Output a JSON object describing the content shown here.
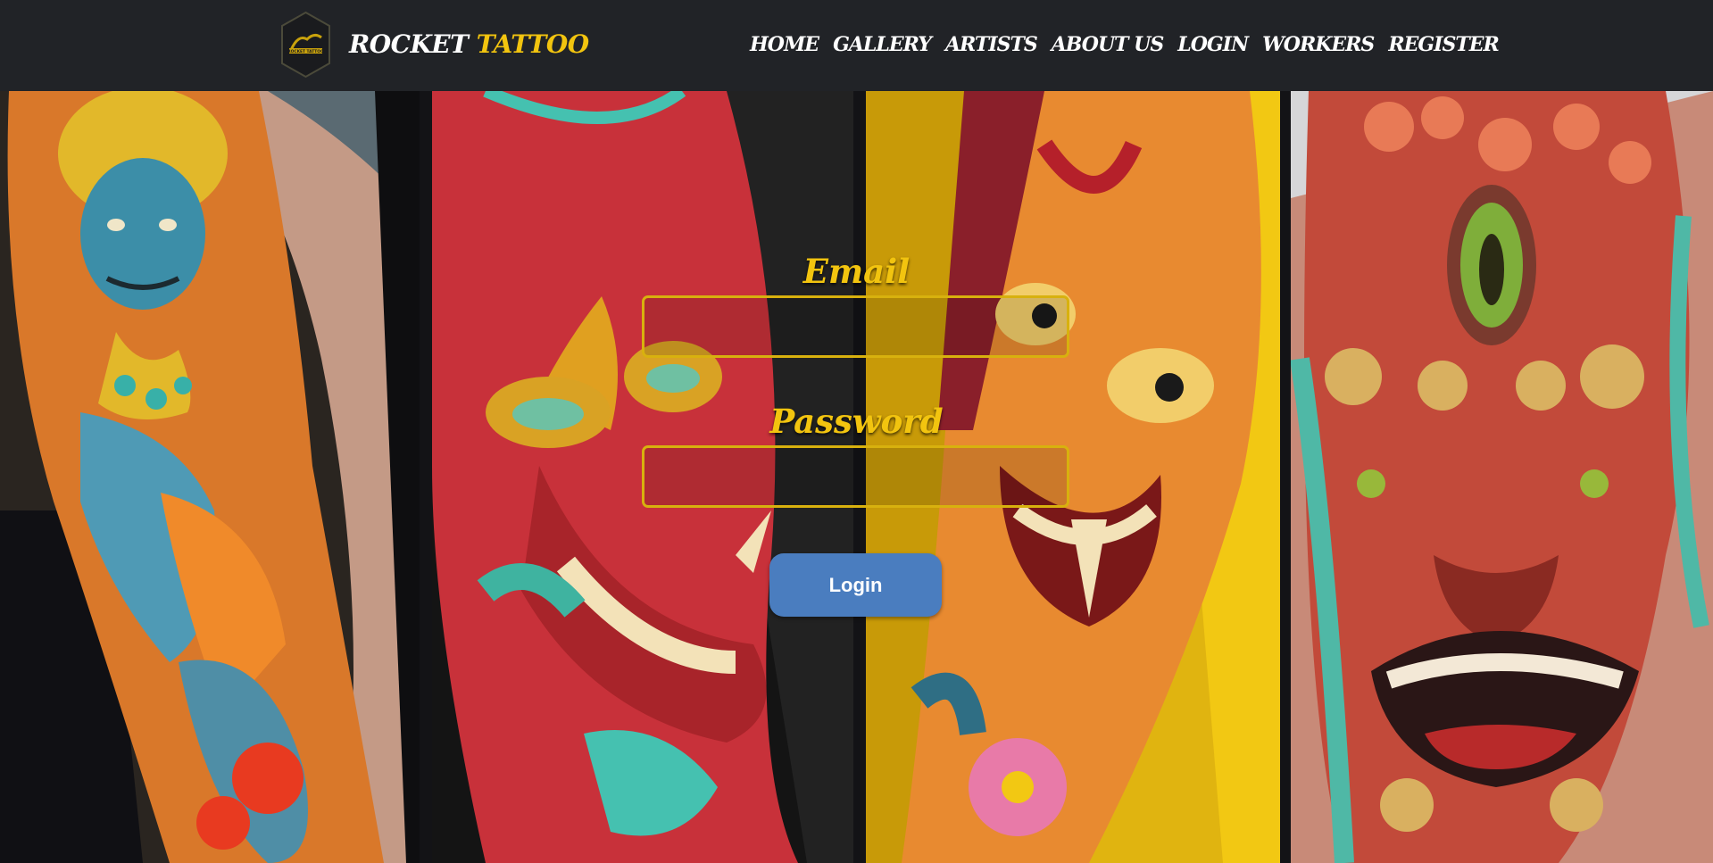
{
  "brand": {
    "name_white": "ROCKET",
    "name_yellow": "TATTOO",
    "logo_text": "ROCKET TATTOO"
  },
  "nav": {
    "items": [
      {
        "label": "HOME"
      },
      {
        "label": "GALLERY"
      },
      {
        "label": "ARTISTS"
      },
      {
        "label": "ABOUT US"
      },
      {
        "label": "LOGIN"
      },
      {
        "label": "WORKERS"
      },
      {
        "label": "REGISTER"
      }
    ]
  },
  "gallery": {
    "panels": [
      {
        "subject": "blue-oni-sleeve-tattoo"
      },
      {
        "subject": "red-hannya-mask-tattoo"
      },
      {
        "subject": "orange-hannya-mask-tattoo"
      },
      {
        "subject": "foo-dog-hand-tattoo"
      }
    ]
  },
  "form": {
    "email_label": "Email",
    "email_value": "",
    "password_label": "Password",
    "password_value": "",
    "submit_label": "Login"
  },
  "colors": {
    "header_bg": "#212327",
    "accent_yellow": "#f2c40f",
    "button_blue": "#4a7dbf"
  }
}
